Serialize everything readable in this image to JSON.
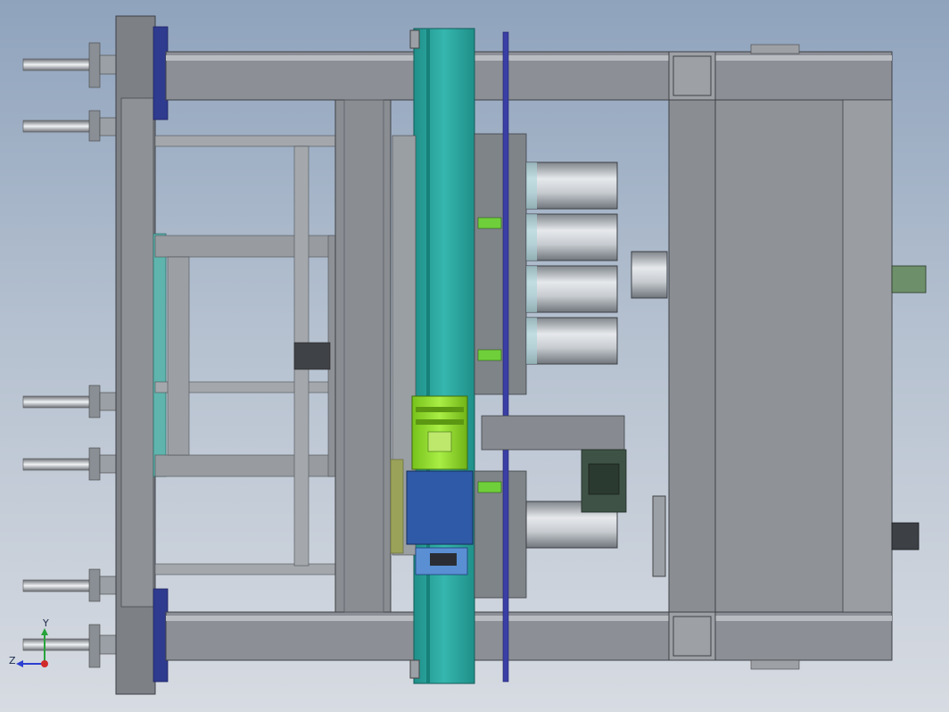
{
  "viewport": {
    "view_type": "CAD assembly viewport (top view)",
    "background_gradient": [
      "#8fa3bd",
      "#d7dbe2"
    ]
  },
  "triad": {
    "x_label": "",
    "y_label": "Y",
    "z_label": "Z",
    "colors": {
      "x": "#d12a2a",
      "y": "#27a33a",
      "z": "#2a3fd1"
    }
  },
  "colors": {
    "frame": "#8c9096",
    "frame_dark": "#5d6066",
    "frame_light": "#b9bdc2",
    "teal": "#2aa7a0",
    "navy": "#2f3b8f",
    "motor_green": "#8fd82a",
    "gearbox_blue": "#2f5aa8",
    "cylinder": "#a7adb3",
    "olive": "#9aa25a",
    "clamp_dark": "#3e5346"
  }
}
